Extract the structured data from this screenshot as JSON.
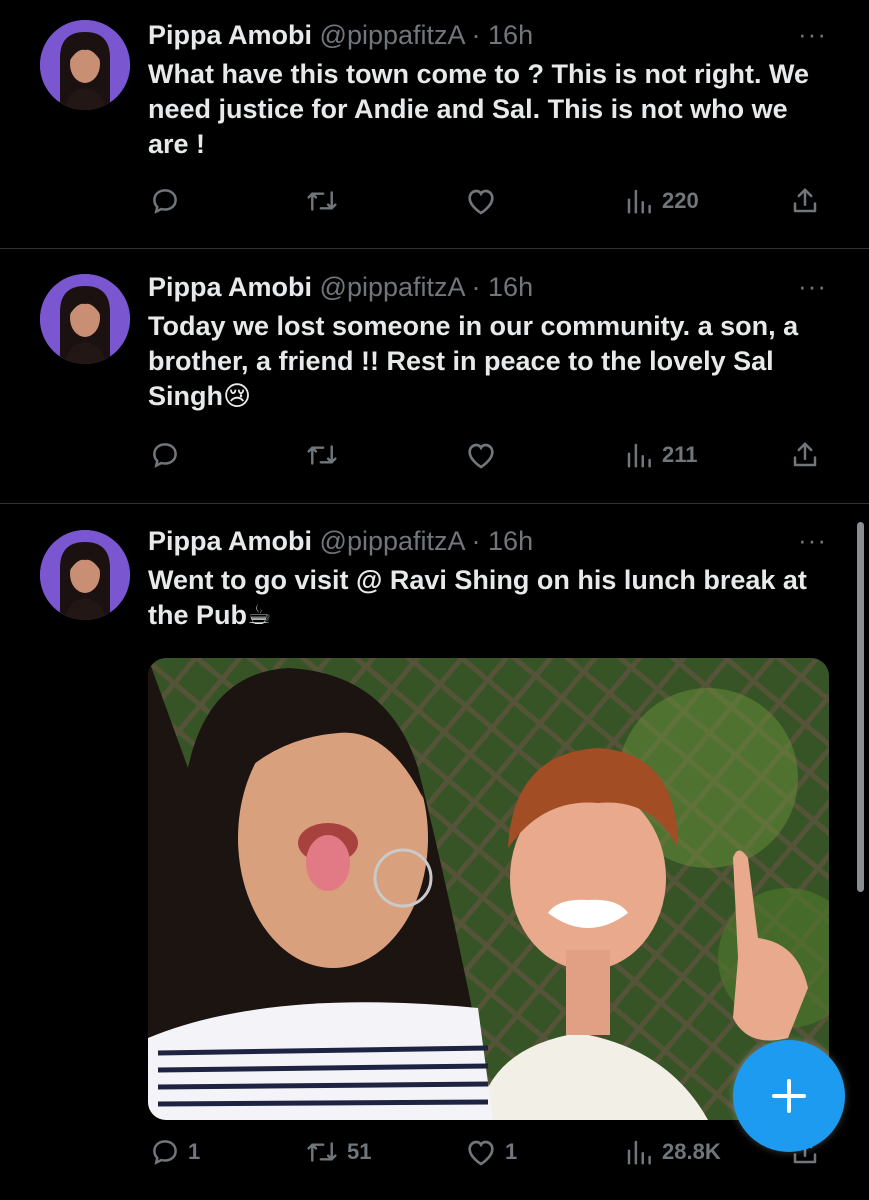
{
  "tweets": [
    {
      "name": "Pippa Amobi",
      "handle": "@pippafitzA",
      "time": "· 16h",
      "more": "···",
      "text": "What have this town come to ? This is not right. We need justice for Andie and Sal. This is not who we are !",
      "replies": "",
      "retweets": "",
      "likes": "",
      "views": "220"
    },
    {
      "name": "Pippa Amobi",
      "handle": "@pippafitzA",
      "time": "· 16h",
      "more": "···",
      "text": "Today we lost someone in our community. a son, a brother, a friend !! Rest in peace to the lovely Sal Singh😢",
      "replies": "",
      "retweets": "",
      "likes": "",
      "views": "211"
    },
    {
      "name": "Pippa Amobi",
      "handle": "@pippafitzA",
      "time": "· 16h",
      "more": "···",
      "text": "Went to go visit @ Ravi Shing on his lunch break at the Pub☕",
      "replies": "1",
      "retweets": "51",
      "likes": "1",
      "views": "28.8K"
    }
  ],
  "fab": {
    "label": "+"
  },
  "colors": {
    "accent": "#1d9bf0",
    "muted": "#71767b",
    "text": "#e7e9ea",
    "background": "#000000"
  }
}
